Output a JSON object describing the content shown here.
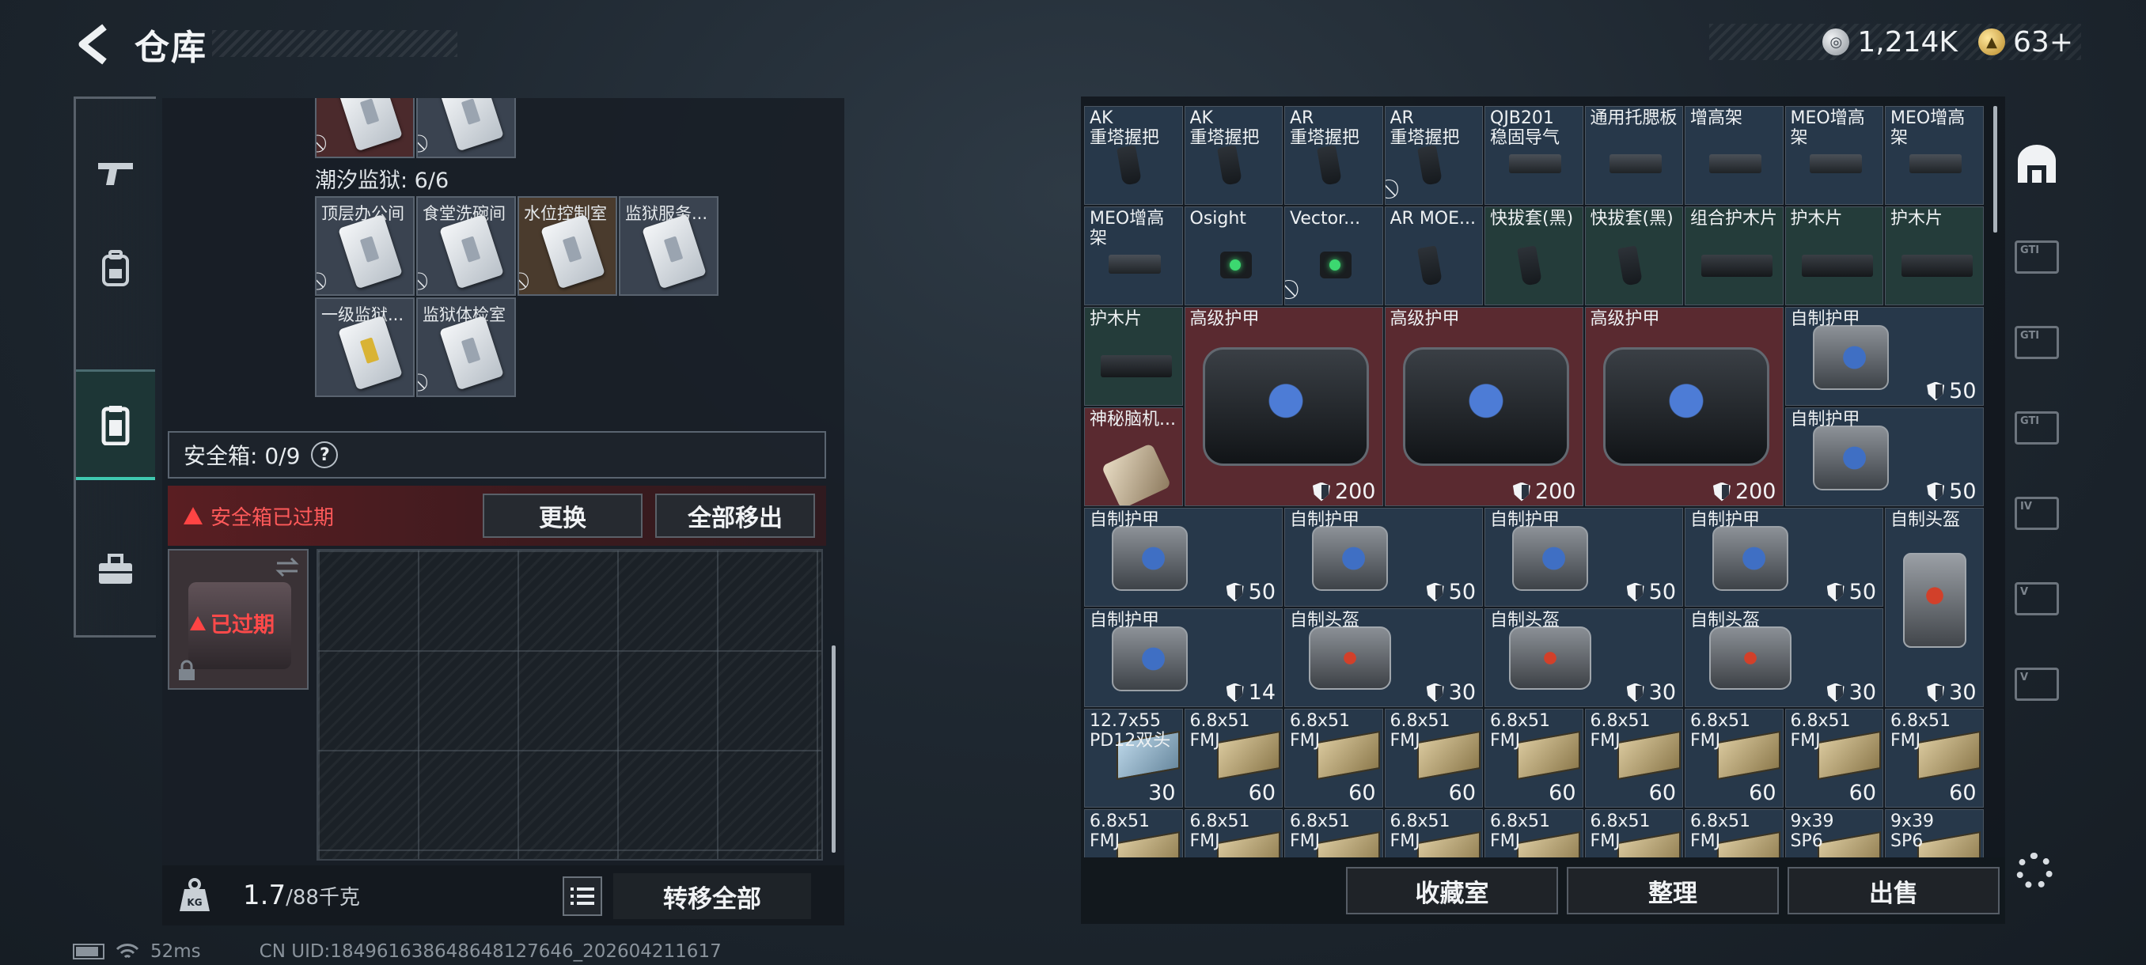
{
  "header": {
    "title": "仓库",
    "currency": [
      {
        "icon": "silver-coin-icon",
        "value": "1,214K"
      },
      {
        "icon": "gold-coin-icon",
        "value": "63+"
      }
    ]
  },
  "left_nav": {
    "items": [
      {
        "icon": "gun-icon",
        "active": false
      },
      {
        "icon": "backpack-icon",
        "active": false
      },
      {
        "icon": "safebox-icon",
        "active": true
      },
      {
        "icon": "toolbox-icon",
        "active": false
      }
    ]
  },
  "keycards": {
    "top_row": [
      "",
      ""
    ],
    "section_label": "潮汐监狱: 6/6",
    "cards": [
      {
        "label": "顶层办公间",
        "tint": "default"
      },
      {
        "label": "食堂洗碗间",
        "tint": "default"
      },
      {
        "label": "水位控制室",
        "tint": "orange"
      },
      {
        "label": "监狱服务...",
        "tint": "default"
      },
      {
        "label": "一级监狱...",
        "tint": "default"
      },
      {
        "label": "监狱体检室",
        "tint": "default"
      }
    ],
    "no_carry_symbol": "⃠"
  },
  "safebox": {
    "label": "安全箱: 0/9",
    "help": "?",
    "warning": "安全箱已过期",
    "replace_btn": "更换",
    "remove_all_btn": "全部移出",
    "expired_label": "已过期"
  },
  "bottom": {
    "weight_value": "1.7",
    "weight_max": "/88千克",
    "transfer_btn": "转移全部"
  },
  "status": {
    "ping": "52ms",
    "uid": "CN UID:18496163864864812764​6_202604211617"
  },
  "stash": {
    "rows": [
      [
        {
          "label": "AK\n重塔握把",
          "bg": "blue",
          "art": "grip"
        },
        {
          "label": "AK\n重塔握把",
          "bg": "blue",
          "art": "grip"
        },
        {
          "label": "AR\n重塔握把",
          "bg": "blue",
          "art": "grip"
        },
        {
          "label": "AR\n重塔握把",
          "bg": "blue",
          "art": "grip",
          "nocarry": true
        },
        {
          "label": "QJB201\n稳固导气",
          "bg": "blue",
          "art": "mount"
        },
        {
          "label": "通用托腮板",
          "bg": "blue",
          "art": "mount"
        },
        {
          "label": "增高架",
          "bg": "blue",
          "art": "mount"
        },
        {
          "label": "MEO增高架",
          "bg": "blue",
          "art": "mount"
        },
        {
          "label": "MEO增高架",
          "bg": "blue",
          "art": "mount"
        }
      ],
      [
        {
          "label": "MEO增高架",
          "bg": "blue",
          "art": "mount"
        },
        {
          "label": "Osight",
          "bg": "blue",
          "art": "sight"
        },
        {
          "label": "Vector...",
          "bg": "blue",
          "art": "sight",
          "nocarry": true
        },
        {
          "label": "AR MOE...",
          "bg": "blue",
          "art": "grip"
        },
        {
          "label": "快拔套(黑)",
          "bg": "teal",
          "art": "grip"
        },
        {
          "label": "快拔套(黑)",
          "bg": "teal",
          "art": "grip"
        },
        {
          "label": "组合护木片",
          "bg": "teal",
          "art": "rail"
        },
        {
          "label": "护木片",
          "bg": "teal",
          "art": "rail"
        },
        {
          "label": "护木片",
          "bg": "teal",
          "art": "rail"
        }
      ]
    ],
    "row3_small": [
      {
        "label": "护木片",
        "bg": "teal",
        "art": "rail"
      },
      {
        "label": "神秘脑机...",
        "bg": "red",
        "art": "brain"
      }
    ],
    "big_armor": [
      {
        "label": "高级护甲",
        "count": "200"
      },
      {
        "label": "高级护甲",
        "count": "200"
      },
      {
        "label": "高级护甲",
        "count": "200"
      }
    ],
    "armor_col9": [
      {
        "label": "自制护甲",
        "count": "50"
      },
      {
        "label": "自制护甲",
        "count": "50"
      }
    ],
    "row5": [
      {
        "label": "自制护甲",
        "count": "50",
        "art": "armor"
      },
      {
        "label": "自制护甲",
        "count": "50",
        "art": "armor"
      },
      {
        "label": "自制护甲",
        "count": "50",
        "art": "armor"
      },
      {
        "label": "自制护甲",
        "count": "50",
        "art": "armor"
      }
    ],
    "helmet_tall": {
      "label": "自制头盔",
      "count": "30"
    },
    "row6": [
      {
        "label": "自制护甲",
        "count": "14",
        "art": "armor"
      },
      {
        "label": "自制头盔",
        "count": "30",
        "art": "helmet"
      },
      {
        "label": "自制头盔",
        "count": "30",
        "art": "helmet"
      },
      {
        "label": "自制头盔",
        "count": "30",
        "art": "helmet"
      }
    ],
    "ammo_row": [
      {
        "label": "12.7x55\nPD12双头",
        "count": "30",
        "blue": true
      },
      {
        "label": "6.8x51\nFMJ",
        "count": "60"
      },
      {
        "label": "6.8x51\nFMJ",
        "count": "60"
      },
      {
        "label": "6.8x51\nFMJ",
        "count": "60"
      },
      {
        "label": "6.8x51\nFMJ",
        "count": "60"
      },
      {
        "label": "6.8x51\nFMJ",
        "count": "60"
      },
      {
        "label": "6.8x51\nFMJ",
        "count": "60"
      },
      {
        "label": "6.8x51\nFMJ",
        "count": "60"
      },
      {
        "label": "6.8x51\nFMJ",
        "count": "60"
      }
    ],
    "ammo_row2": [
      {
        "label": "6.8x51\nFMJ"
      },
      {
        "label": "6.8x51\nFMJ"
      },
      {
        "label": "6.8x51\nFMJ"
      },
      {
        "label": "6.8x51\nFMJ"
      },
      {
        "label": "6.8x51\nFMJ"
      },
      {
        "label": "6.8x51\nFMJ"
      },
      {
        "label": "6.8x51\nFMJ"
      },
      {
        "label": "9x39\nSP6"
      },
      {
        "label": "9x39\nSP6"
      }
    ]
  },
  "right_bottom": {
    "collection_btn": "收藏室",
    "sort_btn": "整理",
    "sell_btn": "出售"
  },
  "right_rail": {
    "tags": [
      "GTI",
      "GTI",
      "GTI",
      "IV",
      "V",
      "V"
    ]
  }
}
